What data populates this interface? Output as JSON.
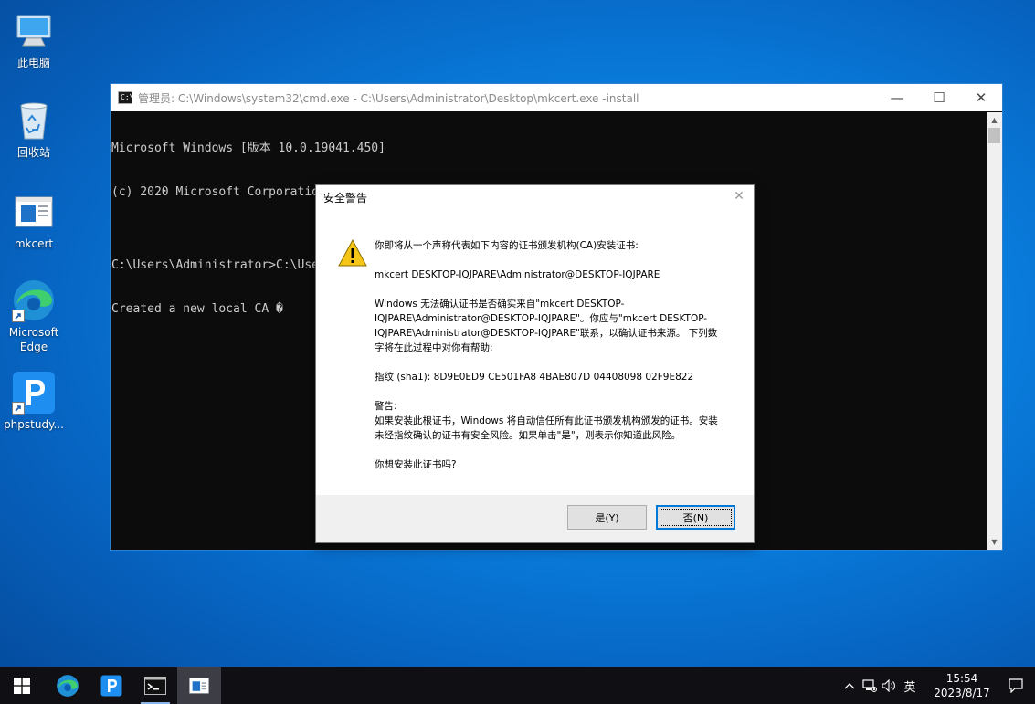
{
  "desktop": {
    "icons": [
      {
        "label": "此电脑"
      },
      {
        "label": "回收站"
      },
      {
        "label": "mkcert"
      },
      {
        "label": "Microsoft Edge"
      },
      {
        "label": "phpstudy..."
      }
    ]
  },
  "cmd": {
    "title": "管理员: C:\\Windows\\system32\\cmd.exe - C:\\Users\\Administrator\\Desktop\\mkcert.exe  -install",
    "icon_text": "C:\\",
    "lines": [
      "Microsoft Windows [版本 10.0.19041.450]",
      "(c) 2020 Microsoft Corporation. 保留所有权利。",
      "",
      "C:\\Users\\Administrator>C:\\Users\\Administrator\\Desktop\\mkcert.exe -install",
      "Created a new local CA �"
    ],
    "minimize": "—",
    "maximize": "☐",
    "close": "✕"
  },
  "dialog": {
    "title": "安全警告",
    "close": "✕",
    "p1": "你即将从一个声称代表如下内容的证书颁发机构(CA)安装证书:",
    "p2": "mkcert DESKTOP-IQJPARE\\Administrator@DESKTOP-IQJPARE",
    "p3": "Windows 无法确认证书是否确实来自\"mkcert DESKTOP-IQJPARE\\Administrator@DESKTOP-IQJPARE\"。你应与\"mkcert DESKTOP-IQJPARE\\Administrator@DESKTOP-IQJPARE\"联系，以确认证书来源。 下列数字将在此过程中对你有帮助:",
    "p4": "指纹 (sha1): 8D9E0ED9 CE501FA8 4BAE807D 04408098 02F9E822",
    "p5_title": "警告:",
    "p5": "如果安装此根证书，Windows 将自动信任所有此证书颁发机构颁发的证书。安装未经指纹确认的证书有安全风险。如果单击\"是\"，则表示你知道此风险。",
    "p6": "你想安装此证书吗?",
    "yes_label": "是(Y)",
    "no_label": "否(N)"
  },
  "taskbar": {
    "input_method": "英",
    "time": "15:54",
    "date": "2023/8/17"
  },
  "colors": {
    "accent": "#0078d7",
    "desktop": "#0a86e6",
    "taskbar": "#0f0f14"
  }
}
